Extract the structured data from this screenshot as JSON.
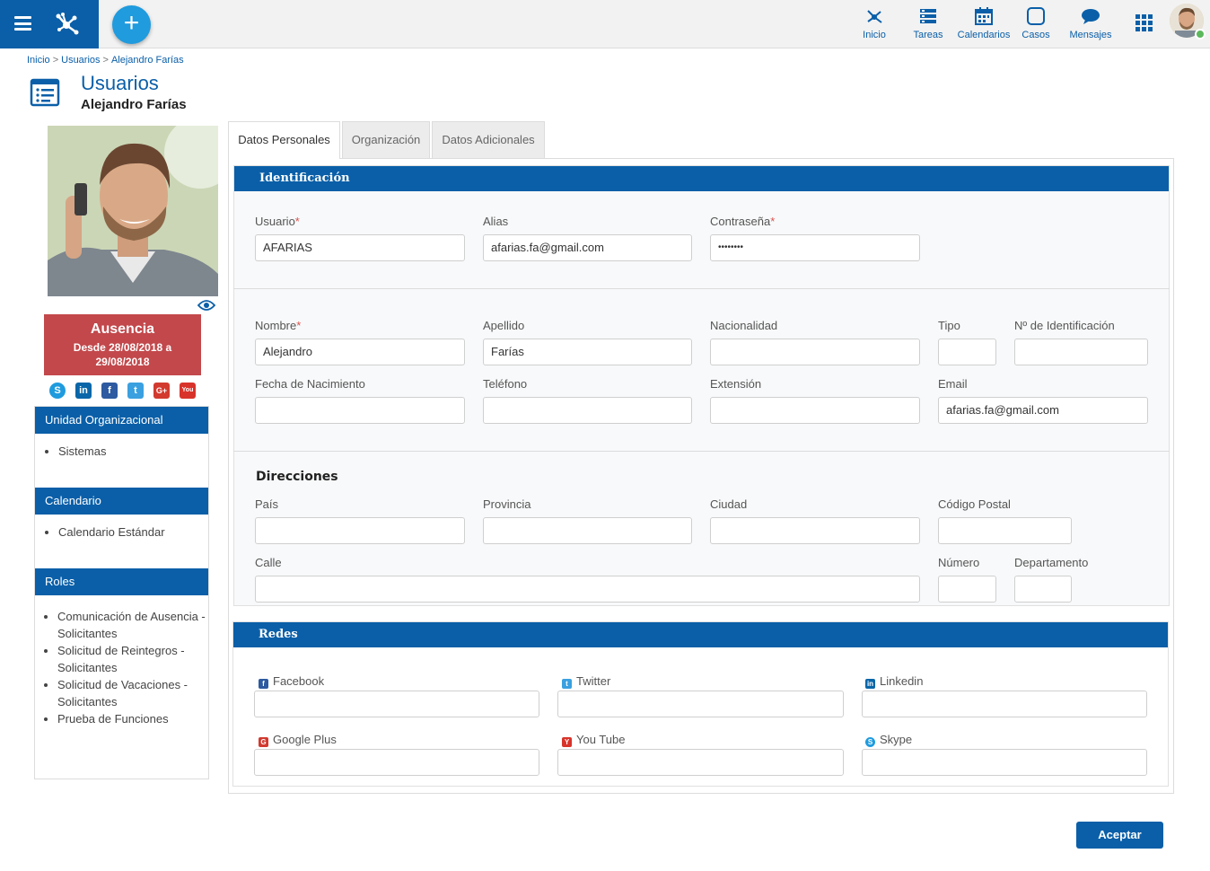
{
  "topnav": {
    "items": [
      {
        "label": "Inicio"
      },
      {
        "label": "Tareas"
      },
      {
        "label": "Calendarios"
      },
      {
        "label": "Casos"
      },
      {
        "label": "Mensajes"
      }
    ],
    "add_label": "+"
  },
  "breadcrumb": {
    "items": [
      "Inicio",
      "Usuarios",
      "Alejandro Farías"
    ],
    "separator": ">"
  },
  "header": {
    "title": "Usuarios",
    "subtitle": "Alejandro Farías"
  },
  "profile": {
    "absence": {
      "title": "Ausencia",
      "dates_line1": "Desde 28/08/2018 a",
      "dates_line2": "29/08/2018"
    },
    "social_icons": [
      "skype-icon",
      "linkedin-icon",
      "facebook-icon",
      "twitter-icon",
      "google-plus-icon",
      "youtube-icon"
    ],
    "panels": {
      "unidad": {
        "title": "Unidad Organizacional",
        "items": [
          "Sistemas"
        ]
      },
      "calendario": {
        "title": "Calendario",
        "items": [
          "Calendario Estándar"
        ]
      },
      "roles": {
        "title": "Roles",
        "items": [
          "Comunicación de Ausencia -",
          "Solicitantes",
          "Solicitud de Reintegros -",
          "Solicitantes",
          "Solicitud de Vacaciones -",
          "Solicitantes",
          "Prueba de Funciones"
        ]
      }
    }
  },
  "tabs": [
    {
      "label": "Datos Personales",
      "active": true
    },
    {
      "label": "Organización",
      "active": false
    },
    {
      "label": "Datos Adicionales",
      "active": false
    }
  ],
  "identificacion": {
    "title": "Identificación",
    "usuario": {
      "label": "Usuario",
      "value": "AFARIAS"
    },
    "alias": {
      "label": "Alias",
      "value": "afarias.fa@gmail.com"
    },
    "contrasena": {
      "label": "Contraseña",
      "value": "••••••••"
    }
  },
  "personales": {
    "nombre": {
      "label": "Nombre",
      "value": "Alejandro"
    },
    "apellido": {
      "label": "Apellido",
      "value": "Farías"
    },
    "nacionalidad": {
      "label": "Nacionalidad",
      "value": ""
    },
    "tipo": {
      "label": "Tipo",
      "value": ""
    },
    "nro_identificacion": {
      "label": "Nº de Identificación",
      "value": ""
    },
    "fecha_nacimiento": {
      "label": "Fecha de Nacimiento",
      "value": ""
    },
    "telefono": {
      "label": "Teléfono",
      "value": ""
    },
    "extension": {
      "label": "Extensión",
      "value": ""
    },
    "email": {
      "label": "Email",
      "value": "afarias.fa@gmail.com"
    }
  },
  "direcciones": {
    "title": "Direcciones",
    "pais": {
      "label": "País",
      "value": ""
    },
    "provincia": {
      "label": "Provincia",
      "value": ""
    },
    "ciudad": {
      "label": "Ciudad",
      "value": ""
    },
    "codigo_postal": {
      "label": "Código Postal",
      "value": ""
    },
    "calle": {
      "label": "Calle",
      "value": ""
    },
    "numero": {
      "label": "Número",
      "value": ""
    },
    "departamento": {
      "label": "Departamento",
      "value": ""
    }
  },
  "redes": {
    "title": "Redes",
    "facebook": {
      "label": "Facebook",
      "value": ""
    },
    "twitter": {
      "label": "Twitter",
      "value": ""
    },
    "linkedin": {
      "label": "Linkedin",
      "value": ""
    },
    "google_plus": {
      "label": "Google Plus",
      "value": ""
    },
    "youtube": {
      "label": "You Tube",
      "value": ""
    },
    "skype": {
      "label": "Skype",
      "value": ""
    }
  },
  "actions": {
    "accept_label": "Aceptar"
  },
  "colors": {
    "primary": "#0a5fa8",
    "accent": "#1f9bde",
    "absence": "#c2484b",
    "online": "#5cb85c",
    "required": "#d9534f"
  }
}
